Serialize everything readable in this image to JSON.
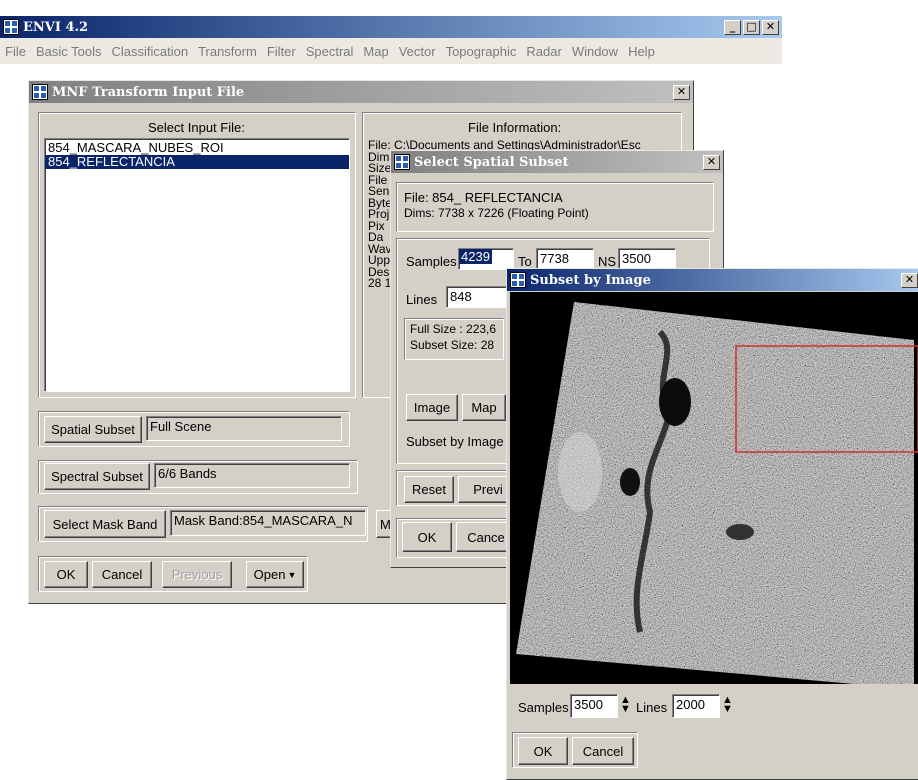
{
  "envi": {
    "title": "ENVI 4.2",
    "menu": [
      "File",
      "Basic Tools",
      "Classification",
      "Transform",
      "Filter",
      "Spectral",
      "Map",
      "Vector",
      "Topographic",
      "Radar",
      "Window",
      "Help"
    ]
  },
  "mnf": {
    "title": "MNF Transform Input File",
    "select_label": "Select Input File:",
    "files": [
      "854_MASCARA_NUBES_ROI",
      "854_REFLECTANCIA"
    ],
    "info_label": "File Information:",
    "info_lines": [
      "File: C:\\Documents and Settings\\Administrador\\Esc",
      "Dims",
      "Size",
      "File",
      "Sen",
      "Byte",
      "Proj",
      "Pix",
      "Da",
      "Wav",
      "Upp",
      "Des",
      "28 1"
    ],
    "spatial_btn": "Spatial Subset",
    "spatial_val": "Full Scene",
    "spectral_btn": "Spectral Subset",
    "spectral_val": "6/6 Bands",
    "mask_btn": "Select Mask Band",
    "mask_val": "Mask Band:854_MASCARA_N",
    "mask_extra": "M",
    "ok": "OK",
    "cancel": "Cancel",
    "previous": "Previous",
    "open": "Open"
  },
  "spatial": {
    "title": "Select Spatial Subset",
    "file": "File: 854_ REFLECTANCIA",
    "dims": "Dims: 7738 x 7226 (Floating Point)",
    "samples_label": "Samples",
    "samples": "4239",
    "to_label": "To",
    "to": "7738",
    "ns_label": "NS",
    "ns": "3500",
    "lines_label": "Lines",
    "lines": "848",
    "full_size": "Full Size  : 223,6",
    "subset_size": "Subset Size: 28",
    "image_btn": "Image",
    "map_btn": "Map",
    "subset_by": "Subset by Image",
    "reset": "Reset",
    "preview": "Previ",
    "ok": "OK",
    "cancel": "Cance"
  },
  "image": {
    "title": "Subset by Image",
    "samples_label": "Samples",
    "samples": "3500",
    "lines_label": "Lines",
    "lines": "2000",
    "ok": "OK",
    "cancel": "Cancel"
  }
}
